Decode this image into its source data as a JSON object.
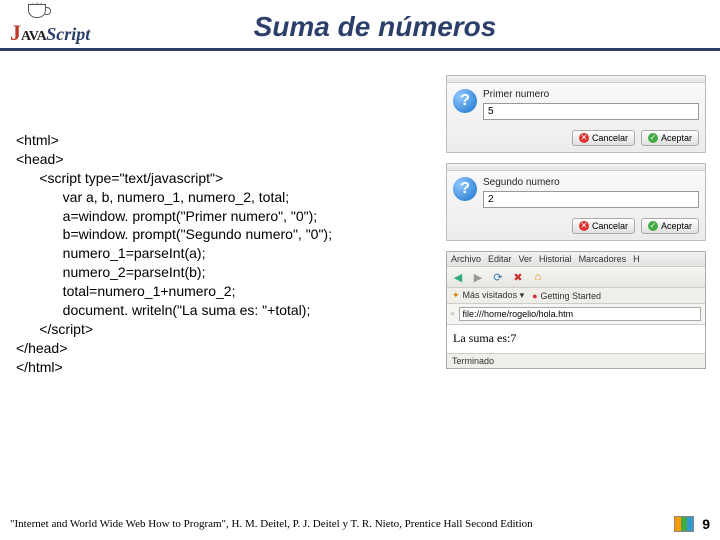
{
  "header": {
    "logo_j": "J",
    "logo_ava": "AVA",
    "logo_script": "Script",
    "title": "Suma de números"
  },
  "code": "<html>\n<head>\n      <script type=\"text/javascript\">\n            var a, b, numero_1, numero_2, total;\n            a=window. prompt(\"Primer numero\", \"0\");\n            b=window. prompt(\"Segundo numero\", \"0\");\n            numero_1=parseInt(a);\n            numero_2=parseInt(b);\n            total=numero_1+numero_2;\n            document. writeln(\"La suma es: \"+total);\n      </script>\n</head>\n</html>",
  "dialog1": {
    "title": "",
    "label": "Primer numero",
    "value": "5",
    "cancel": "Cancelar",
    "accept": "Aceptar"
  },
  "dialog2": {
    "title": "",
    "label": "Segundo numero",
    "value": "2",
    "cancel": "Cancelar",
    "accept": "Aceptar"
  },
  "browser": {
    "menu": [
      "Archivo",
      "Editar",
      "Ver",
      "Historial",
      "Marcadores",
      "H"
    ],
    "bookmarks": {
      "mas": "Más visitados ▾",
      "gs": "Getting Started"
    },
    "url": "file:///home/rogelio/hola.htm",
    "content": "La suma es:7",
    "status": "Terminado"
  },
  "footer": {
    "citation": "\"Internet and World Wide Web How to Program\", H. M. Deitel, P. J. Deitel y T. R. Nieto, Prentice Hall Second Edition",
    "page": "9"
  }
}
